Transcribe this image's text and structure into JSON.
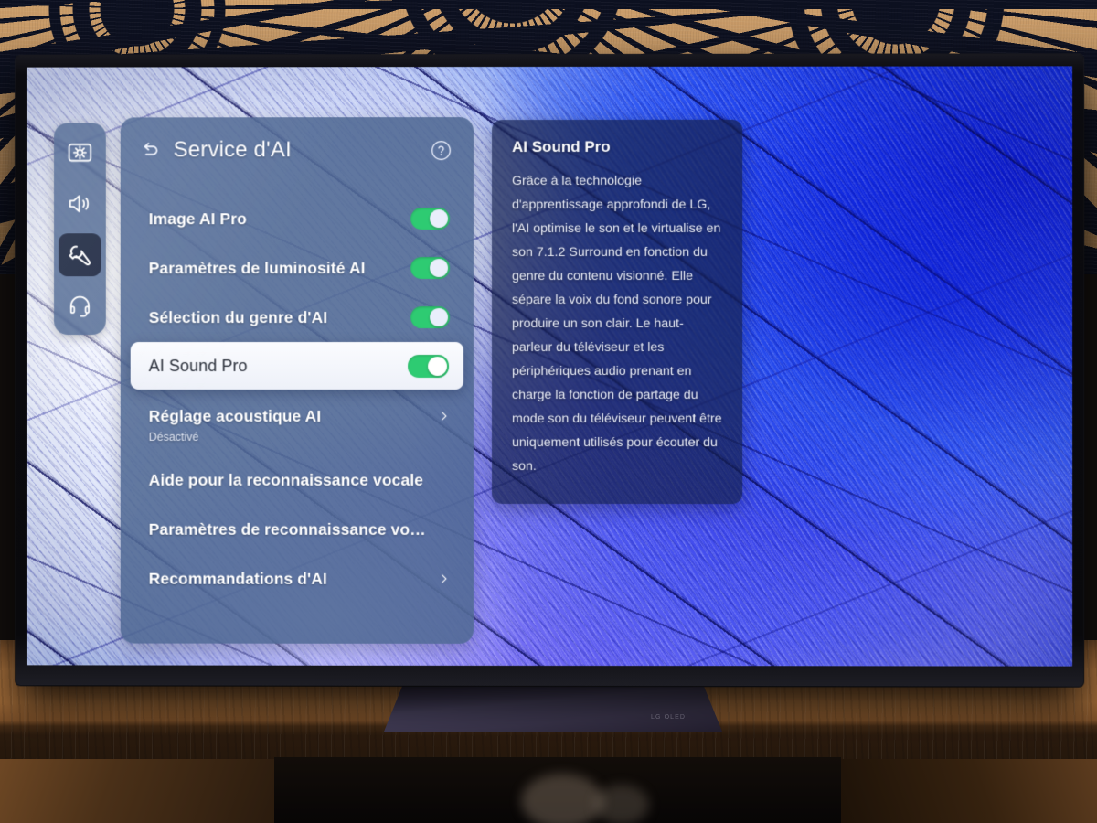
{
  "device": {
    "brand_logo": "LG OLED"
  },
  "sidebar": {
    "items": [
      {
        "icon": "picture-brightness-icon",
        "label": "Image",
        "selected": false
      },
      {
        "icon": "speaker-sound-icon",
        "label": "Son",
        "selected": false
      },
      {
        "icon": "wrench-general-icon",
        "label": "Général",
        "selected": true
      },
      {
        "icon": "headset-support-icon",
        "label": "Assistance",
        "selected": false
      }
    ]
  },
  "menu": {
    "back_icon": "back-arrow-icon",
    "title": "Service d'AI",
    "help_icon": "help-circle-icon",
    "items": [
      {
        "label": "Image AI Pro",
        "type": "toggle",
        "value": "on",
        "selected": false
      },
      {
        "label": "Paramètres de luminosité AI",
        "type": "toggle",
        "value": "on",
        "selected": false
      },
      {
        "label": "Sélection du genre d'AI",
        "type": "toggle",
        "value": "on",
        "selected": false
      },
      {
        "label": "AI Sound Pro",
        "type": "toggle",
        "value": "on",
        "selected": true
      },
      {
        "label": "Réglage acoustique AI",
        "sub": "Désactivé",
        "type": "link",
        "selected": false
      },
      {
        "label": "Aide pour la reconnaissance vocale",
        "type": "plain",
        "selected": false
      },
      {
        "label": "Paramètres de reconnaissance vo…",
        "type": "plain",
        "selected": false
      },
      {
        "label": "Recommandations d'AI",
        "type": "link",
        "selected": false
      }
    ]
  },
  "description": {
    "title": "AI Sound Pro",
    "body": "Grâce à la technologie d'apprentissage approfondi de LG, l'AI optimise le son et le virtualise en son 7.1.2 Surround en fonction du genre du contenu visionné. Elle sépare la voix du fond sonore pour produire un son clair. Le haut-parleur du téléviseur et les périphériques audio prenant en charge la fonction de partage du mode son du téléviseur peuvent être uniquement utilisés pour écouter du son."
  },
  "colors": {
    "toggle_on": "#2ecb72",
    "panel_bg": "#4f6893",
    "rail_bg": "#46608c",
    "rail_active": "#27314a",
    "selected_row_bg": "#fbfcff",
    "desc_bg": "#141f4a"
  }
}
